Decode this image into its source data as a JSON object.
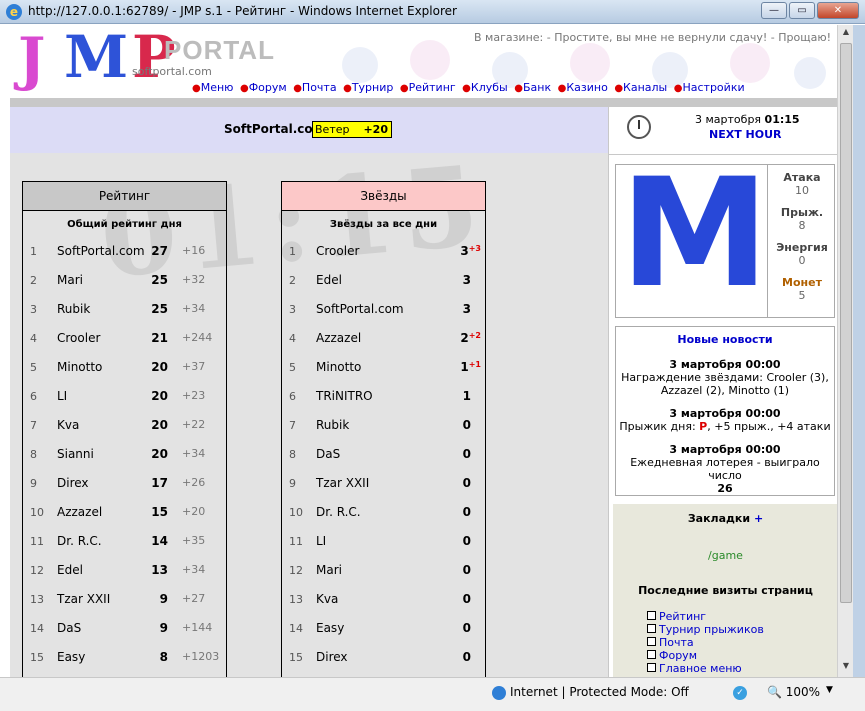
{
  "window": {
    "title": "http://127.0.0.1:62789/ - JMP s.1 - Рейтинг - Windows Internet Explorer"
  },
  "header": {
    "logo_portal": "PORTAL",
    "logo_site": "softportal.com",
    "ticker": "В магазине: - Простите, вы мне не вернули сдачу! - Прощаю!",
    "menu": [
      "Меню",
      "Форум",
      "Почта",
      "Турнир",
      "Рейтинг",
      "Клубы",
      "Банк",
      "Казино",
      "Каналы",
      "Настройки"
    ]
  },
  "notice": {
    "name": "SoftPortal.com",
    "wind_label": "Ветер",
    "wind_value": "+20"
  },
  "clock_watermark": "01:15",
  "rating": {
    "title": "Рейтинг",
    "subtitle": "Общий рейтинг дня",
    "rows": [
      {
        "n": "1",
        "name": "SoftPortal.com",
        "score": "27",
        "delta": "+16"
      },
      {
        "n": "2",
        "name": "Mari",
        "score": "25",
        "delta": "+32"
      },
      {
        "n": "3",
        "name": "Rubik",
        "score": "25",
        "delta": "+34"
      },
      {
        "n": "4",
        "name": "Crooler",
        "score": "21",
        "delta": "+244"
      },
      {
        "n": "5",
        "name": "Minotto",
        "score": "20",
        "delta": "+37"
      },
      {
        "n": "6",
        "name": "LI",
        "score": "20",
        "delta": "+23"
      },
      {
        "n": "7",
        "name": "Kva",
        "score": "20",
        "delta": "+22"
      },
      {
        "n": "8",
        "name": "Sianni",
        "score": "20",
        "delta": "+34"
      },
      {
        "n": "9",
        "name": "Direx",
        "score": "17",
        "delta": "+26"
      },
      {
        "n": "10",
        "name": "Azzazel",
        "score": "15",
        "delta": "+20"
      },
      {
        "n": "11",
        "name": "Dr. R.C.",
        "score": "14",
        "delta": "+35"
      },
      {
        "n": "12",
        "name": "Edel",
        "score": "13",
        "delta": "+34"
      },
      {
        "n": "13",
        "name": "Tzar XXII",
        "score": "9",
        "delta": "+27"
      },
      {
        "n": "14",
        "name": "DaS",
        "score": "9",
        "delta": "+144"
      },
      {
        "n": "15",
        "name": "Easy",
        "score": "8",
        "delta": "+1203"
      }
    ]
  },
  "stars": {
    "title": "Звёзды",
    "subtitle": "Звёзды за все дни",
    "rows": [
      {
        "n": "1",
        "name": "Crooler",
        "score": "3",
        "sup": "+3"
      },
      {
        "n": "2",
        "name": "Edel",
        "score": "3",
        "sup": ""
      },
      {
        "n": "3",
        "name": "SoftPortal.com",
        "score": "3",
        "sup": ""
      },
      {
        "n": "4",
        "name": "Azzazel",
        "score": "2",
        "sup": "+2"
      },
      {
        "n": "5",
        "name": "Minotto",
        "score": "1",
        "sup": "+1"
      },
      {
        "n": "6",
        "name": "TRiNITRO",
        "score": "1",
        "sup": ""
      },
      {
        "n": "7",
        "name": "Rubik",
        "score": "0",
        "sup": ""
      },
      {
        "n": "8",
        "name": "DaS",
        "score": "0",
        "sup": ""
      },
      {
        "n": "9",
        "name": "Tzar XXII",
        "score": "0",
        "sup": ""
      },
      {
        "n": "10",
        "name": "Dr. R.C.",
        "score": "0",
        "sup": ""
      },
      {
        "n": "11",
        "name": "LI",
        "score": "0",
        "sup": ""
      },
      {
        "n": "12",
        "name": "Mari",
        "score": "0",
        "sup": ""
      },
      {
        "n": "13",
        "name": "Kva",
        "score": "0",
        "sup": ""
      },
      {
        "n": "14",
        "name": "Easy",
        "score": "0",
        "sup": ""
      },
      {
        "n": "15",
        "name": "Direx",
        "score": "0",
        "sup": ""
      }
    ]
  },
  "clock": {
    "date": "3 мартобря",
    "time": "01:15",
    "next": "NEXT HOUR"
  },
  "character": {
    "avatar_letter": "M",
    "stats": [
      {
        "label": "Атака",
        "value": "10"
      },
      {
        "label": "Прыж.",
        "value": "8"
      },
      {
        "label": "Энергия",
        "value": "0"
      },
      {
        "label": "Монет",
        "value": "5"
      }
    ]
  },
  "news": {
    "title": "Новые новости",
    "items": [
      {
        "date": "3 мартобря 00:00",
        "text": "Награждение звёздами: Crooler (3), Azzazel (2), Minotto (1)"
      },
      {
        "date": "3 мартобря 00:00",
        "pre": "Прыжик дня: ",
        "hl": "P",
        "post": ", +5 прыж., +4 атаки"
      },
      {
        "date": "3 мартобря 00:00",
        "text": "Ежедневная лотерея - выиграло число",
        "num": "26"
      }
    ]
  },
  "bookmarks": {
    "title": "Закладки",
    "plus": "+",
    "link": "/game"
  },
  "visits": {
    "title": "Последние визиты страниц",
    "items": [
      "Рейтинг",
      "Турнир прыжиков",
      "Почта",
      "Форум",
      "Главное меню"
    ]
  },
  "statusbar": {
    "zone": "Internet | Protected Mode: Off",
    "zoom": "100%"
  }
}
